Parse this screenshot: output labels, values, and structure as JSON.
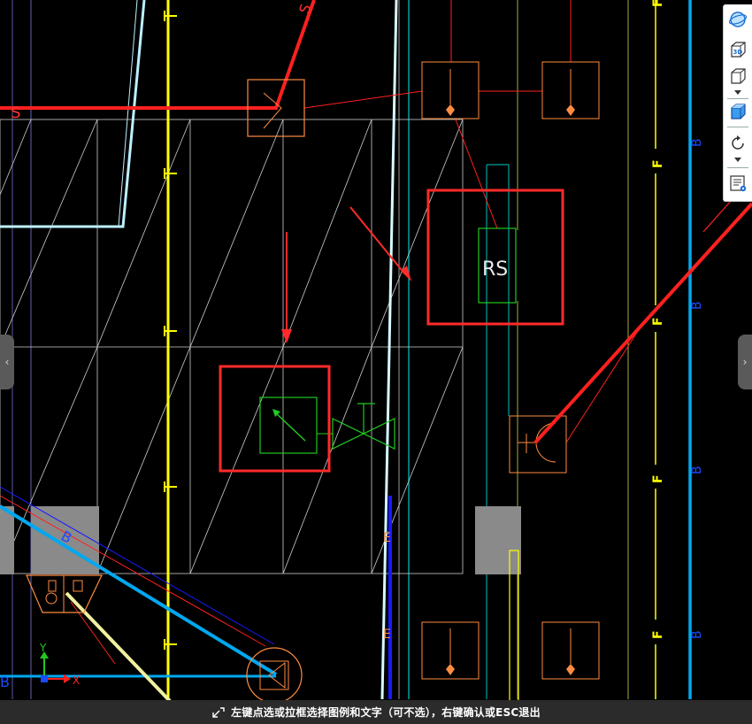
{
  "canvas": {
    "labels": {
      "s_top": "S",
      "s_left": "S",
      "rs": "RS",
      "b": "B",
      "f": "F",
      "e": "E",
      "axis_x": "X",
      "axis_y": "Y"
    }
  },
  "status_bar": {
    "message": "左键点选或拉框选择图例和文字（可不选），右键确认或ESC退出"
  },
  "toolbar": {
    "buttons": [
      "orbit-icon",
      "view-3d-icon",
      "cube-wireframe-icon",
      "cube-shaded-icon",
      "rotate-icon",
      "properties-list-icon"
    ]
  },
  "colors": {
    "background": "#000000",
    "highlight_red": "#ff2a2a",
    "yellow": "#ffff00",
    "cyan": "#00b0f0",
    "orange": "#ff8c40",
    "green": "#22c822",
    "status_bar": "#2b2b2b"
  }
}
